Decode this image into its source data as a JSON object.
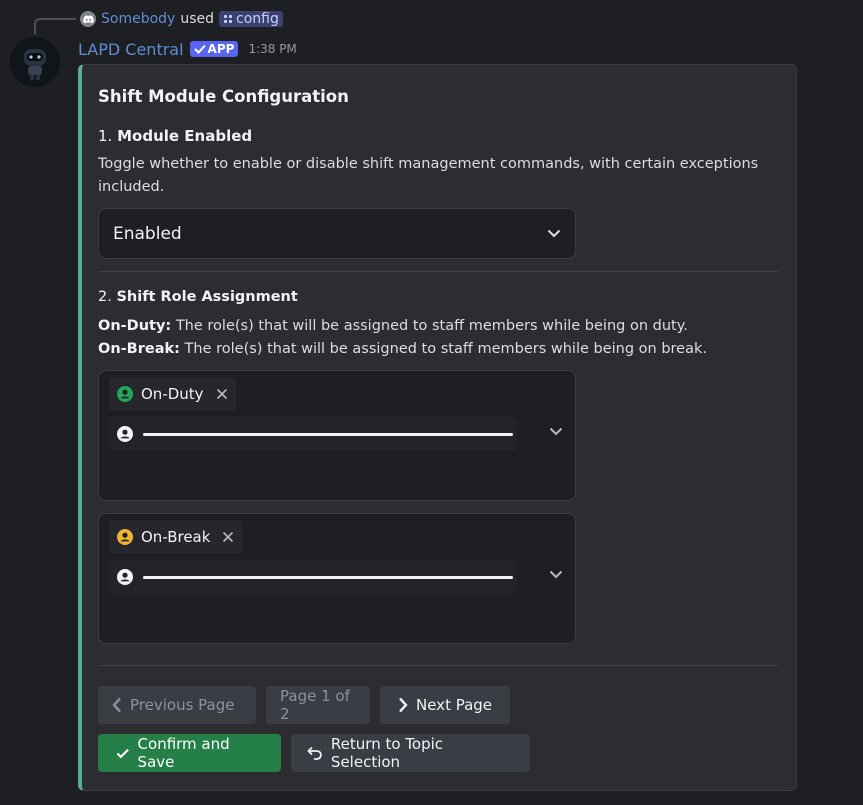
{
  "reply": {
    "user": "Somebody",
    "verb": "used",
    "command": "config"
  },
  "header": {
    "bot_name": "LAPD Central",
    "app_tag": "APP",
    "timestamp": "1:38 PM"
  },
  "embed": {
    "title": "Shift Module Configuration",
    "section1": {
      "number": "1.",
      "heading": "Module Enabled",
      "description": "Toggle whether to enable or disable shift management commands, with certain exceptions included.",
      "select_value": "Enabled"
    },
    "section2": {
      "number": "2.",
      "heading": "Shift Role Assignment",
      "on_duty_label": "On-Duty:",
      "on_duty_desc": "The role(s) that will be assigned to staff members while being on duty.",
      "on_break_label": "On-Break:",
      "on_break_desc": "The role(s) that will be assigned to staff members while being on break."
    },
    "selects": [
      {
        "chip_label": "On-Duty",
        "chip_color": "#23a55a"
      },
      {
        "chip_label": "On-Break",
        "chip_color": "#f0b232"
      }
    ],
    "pagination": {
      "prev_label": "Previous Page",
      "page_indicator": "Page 1 of 2",
      "next_label": "Next Page"
    },
    "actions": {
      "confirm_label": "Confirm and Save",
      "return_label": "Return to Topic Selection"
    }
  },
  "colors": {
    "accent_bar": "#5fa99a",
    "blurple": "#5865f2",
    "success": "#248046"
  }
}
